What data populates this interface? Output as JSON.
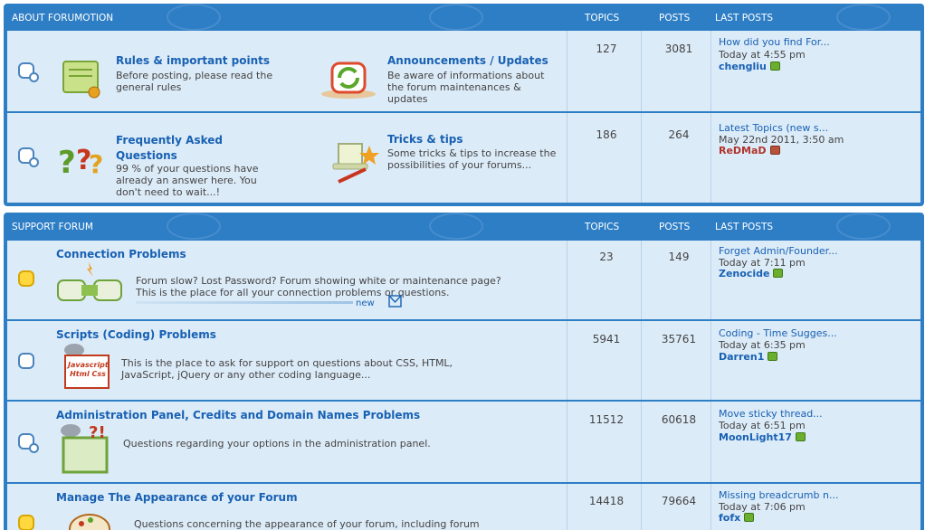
{
  "colors": {
    "header_bg": "#2e7ec6",
    "row_bg": "#dcebf8",
    "link": "#1861b3",
    "user_red": "#b0332b"
  },
  "columns": {
    "topics": "TOPICS",
    "posts": "POSTS",
    "last_posts": "LAST POSTS"
  },
  "categories": [
    {
      "title": "ABOUT FORUMOTION",
      "rows": [
        {
          "subforums": [
            {
              "name": "Rules & important points",
              "desc": "Before posting, please read the general rules",
              "icon": "scroll-certificate-icon"
            },
            {
              "name": "Announcements / Updates",
              "desc": "Be aware of informations about the forum maintenances & updates",
              "icon": "update-arrows-icon"
            }
          ],
          "topics": "127",
          "posts": "3081",
          "last": {
            "title": "How did you find For...",
            "date": "Today at 4:55 pm",
            "user": "chengliu"
          }
        },
        {
          "subforums": [
            {
              "name": "Frequently Asked Questions",
              "desc": "99 % of your questions have already an answer here. You don't need to wait...!",
              "icon": "question-marks-icon"
            },
            {
              "name": "Tricks & tips",
              "desc": "Some tricks & tips to increase the possibilities of your forums...",
              "icon": "magic-hat-icon"
            }
          ],
          "topics": "186",
          "posts": "264",
          "last": {
            "title": "Latest Topics (new s...",
            "date": "May 22nd 2011, 3:50 am",
            "user": "ReDMaD"
          }
        }
      ]
    },
    {
      "title": "SUPPORT FORUM",
      "rows": [
        {
          "name": "Connection Problems",
          "desc_line1": "Forum slow? Lost Password? Forum showing white or maintenance page?",
          "desc_line2": "This is the place for all your connection problems or questions.",
          "new_label": "new",
          "icon": "plug-connection-icon",
          "topics": "23",
          "posts": "149",
          "last": {
            "title": "Forget Admin/Founder...",
            "date": "Today at 7:11 pm",
            "user": "Zenocide"
          }
        },
        {
          "name": "Scripts (Coding) Problems",
          "desc_line1": "This is the place to ask for support on questions about CSS, HTML,",
          "desc_line2": "JavaScript, jQuery or any other coding language...",
          "icon_text_1": "Javascript",
          "icon_text_2": "Html Css",
          "topics": "5941",
          "posts": "35761",
          "last": {
            "title": "Coding - Time Sugges...",
            "date": "Today at 6:35 pm",
            "user": "Darren1"
          }
        },
        {
          "name": "Administration Panel, Credits and Domain Names Problems",
          "desc_line1": "Questions regarding your options in the administration panel.",
          "icon": "admin-panel-icon",
          "topics": "11512",
          "posts": "60618",
          "last": {
            "title": "Move sticky thread...",
            "date": "Today at 6:51 pm",
            "user": "MoonLight17"
          }
        },
        {
          "name": "Manage The Appearance of your Forum",
          "desc_line1": "Questions concerning the appearance of your forum, including forum",
          "icon": "paint-palette-icon",
          "topics": "14418",
          "posts": "79664",
          "last": {
            "title": "Missing breadcrumb n...",
            "date": "Today at 7:06 pm",
            "user": "fofx"
          }
        }
      ]
    }
  ]
}
